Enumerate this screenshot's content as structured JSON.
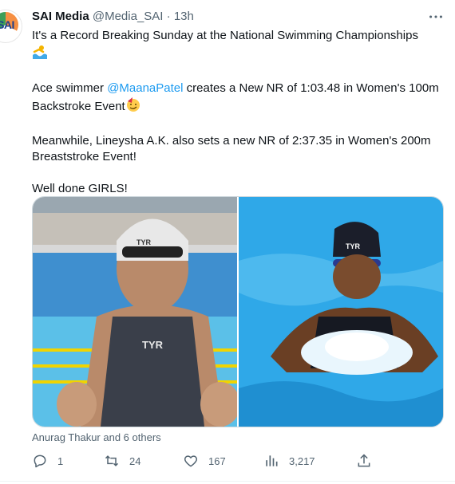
{
  "tweet": {
    "avatar_text": "SAI",
    "display_name": "SAI Media",
    "handle": "@Media_SAI",
    "separator": "·",
    "time": "13h",
    "lines": {
      "line1": "It's a Record Breaking Sunday at the National Swimming Championships",
      "line2_prefix": "Ace swimmer ",
      "mention": "@MaanaPatel",
      "line2_suffix": " creates a New NR of 1:03.48 in Women's 100m Backstroke Event",
      "line3": "Meanwhile, Lineysha A.K. also sets a new NR of 2:37.35 in Women's 200m Breaststroke Event!",
      "line4": "Well done GIRLS!"
    },
    "photo_labels": {
      "left_cap_logo": "TYR",
      "left_suit_logo": "TYR",
      "right_cap_logo": "TYR"
    },
    "liked_by": "Anurag Thakur and 6 others",
    "actions": {
      "replies": "1",
      "retweets": "24",
      "likes": "167",
      "views": "3,217"
    },
    "icons": {
      "more": "more-icon",
      "reply": "reply-icon",
      "retweet": "retweet-icon",
      "like": "heart-icon",
      "views": "views-icon",
      "share": "share-icon"
    },
    "colors": {
      "accent": "#1d9bf0",
      "secondary": "#536471",
      "text": "#0f1419"
    }
  }
}
